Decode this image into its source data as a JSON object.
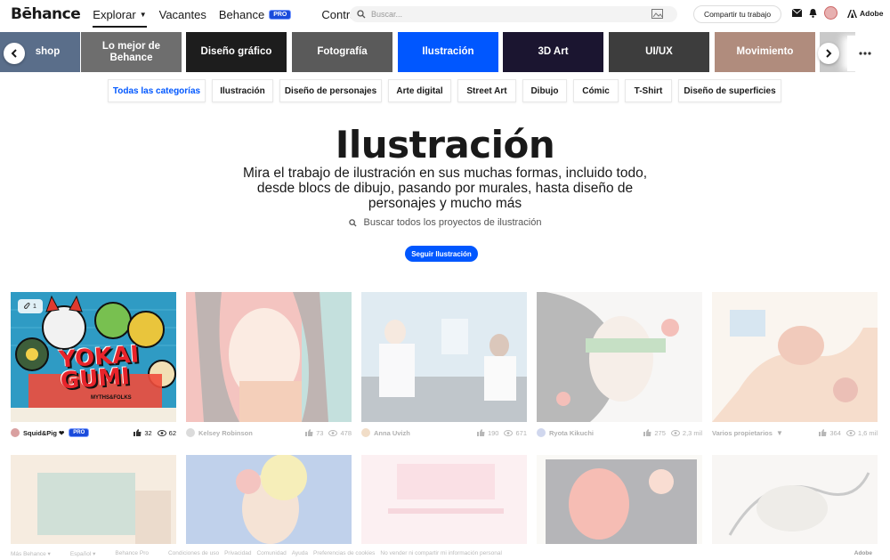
{
  "nav": {
    "logo": "Bēhance",
    "explore": "Explorar",
    "jobs": "Vacantes",
    "behance_pro": "Behance",
    "pro_badge": "PRO",
    "hire": "Contratar a autónomos",
    "search_placeholder": "Buscar...",
    "share": "Compartir tu trabajo",
    "adobe": "Adobe"
  },
  "carousel": {
    "tiles": [
      {
        "label": "shop",
        "color": "#5a6e8a"
      },
      {
        "label": "Lo mejor de Behance",
        "color": "#6e6e6e"
      },
      {
        "label": "Diseño gráfico",
        "color": "#1d1d1d"
      },
      {
        "label": "Fotografía",
        "color": "#5a5a5a"
      },
      {
        "label": "Ilustración",
        "color": "#0057ff"
      },
      {
        "label": "3D Art",
        "color": "#1b1530"
      },
      {
        "label": "UI/UX",
        "color": "#3d3d3d"
      },
      {
        "label": "Movimiento",
        "color": "#b08c7d"
      }
    ]
  },
  "subcategories": [
    "Todas las categorías",
    "Ilustración",
    "Diseño de personajes",
    "Arte digital",
    "Street Art",
    "Dibujo",
    "Cómic",
    "T-Shirt",
    "Diseño de superficies"
  ],
  "hero": {
    "title": "Ilustración",
    "description": "Mira el trabajo de ilustración en sus muchas formas, incluido todo, desde blocs de dibujo, pasando por murales, hasta diseño de personajes y mucho más",
    "search": "Buscar todos los proyectos de ilustración",
    "follow": "Seguir Ilustración"
  },
  "projects": [
    {
      "owner": "Squid&Pig ❤",
      "pro": "PRO",
      "likes": "32",
      "views": "62",
      "art_text": "YOKAI GUMI",
      "art_sub": "MYTHS&FOLKS",
      "badge_count": "1"
    },
    {
      "owner": "Kelsey Robinson",
      "likes": "73",
      "views": "478"
    },
    {
      "owner": "Anna Uvizh",
      "likes": "190",
      "views": "671"
    },
    {
      "owner": "Ryota Kikuchi",
      "likes": "275",
      "views": "2,3 mil"
    },
    {
      "owner": "Varios propietarios",
      "likes": "364",
      "views": "1,6 mil"
    }
  ],
  "footer": [
    "Más Behance ▾",
    "Español ▾",
    "Behance Pro",
    "Condiciones de uso",
    "Privacidad",
    "Comunidad",
    "Ayuda",
    "Preferencias de cookies",
    "No vender ni compartir mi información personal"
  ],
  "footer_adobe": "Adobe"
}
